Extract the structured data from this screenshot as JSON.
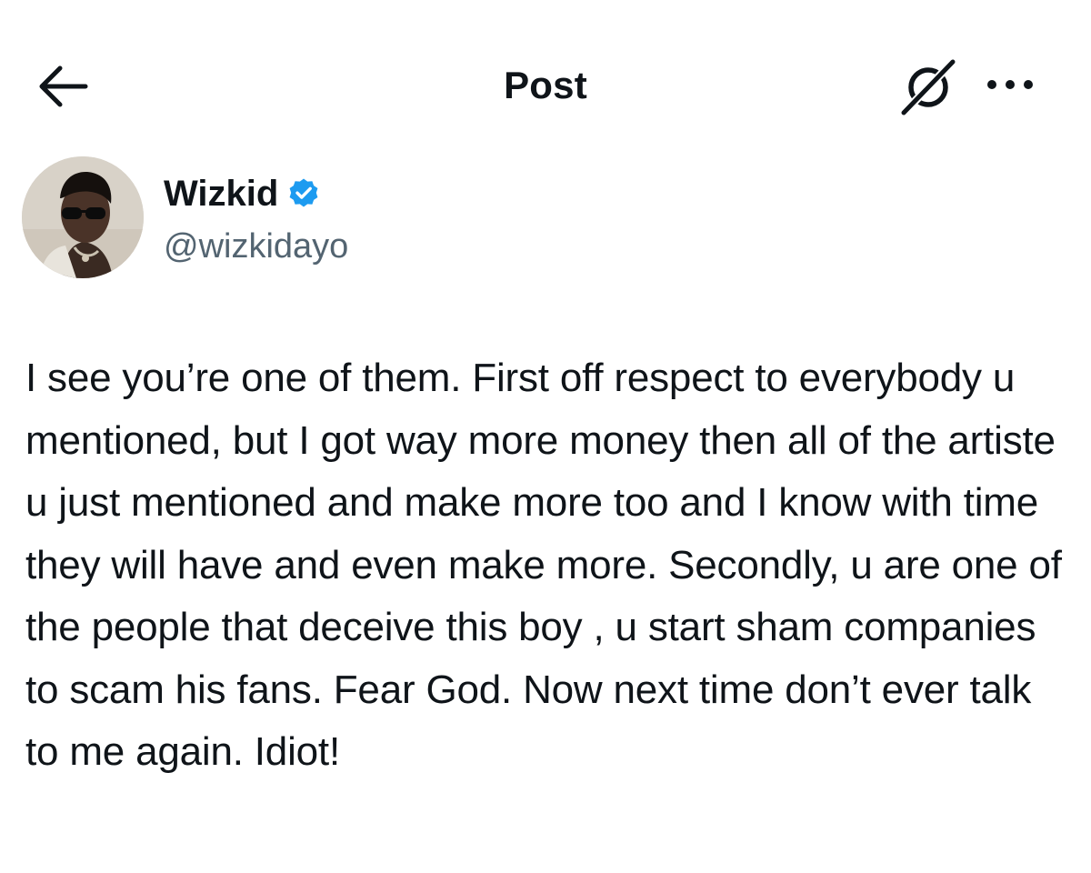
{
  "header": {
    "title": "Post",
    "back_icon": "arrow-left-icon",
    "grok_icon": "grok-icon",
    "more_icon": "more-horizontal-icon"
  },
  "author": {
    "display_name": "Wizkid",
    "handle": "@wizkidayo",
    "verified": true,
    "verified_color": "#1d9bf0"
  },
  "post": {
    "text": "I see you’re one of them. First off respect to everybody u mentioned, but I got way more money then all of the artiste u just mentioned and make more too and I know with time they will have and even make more. Secondly, u are one of the people that deceive this boy , u start sham companies to scam his fans. Fear God. Now next time don’t ever talk to me again. Idiot!"
  },
  "colors": {
    "text_primary": "#0f1419",
    "text_secondary": "#536471",
    "background": "#ffffff",
    "accent": "#1d9bf0"
  }
}
